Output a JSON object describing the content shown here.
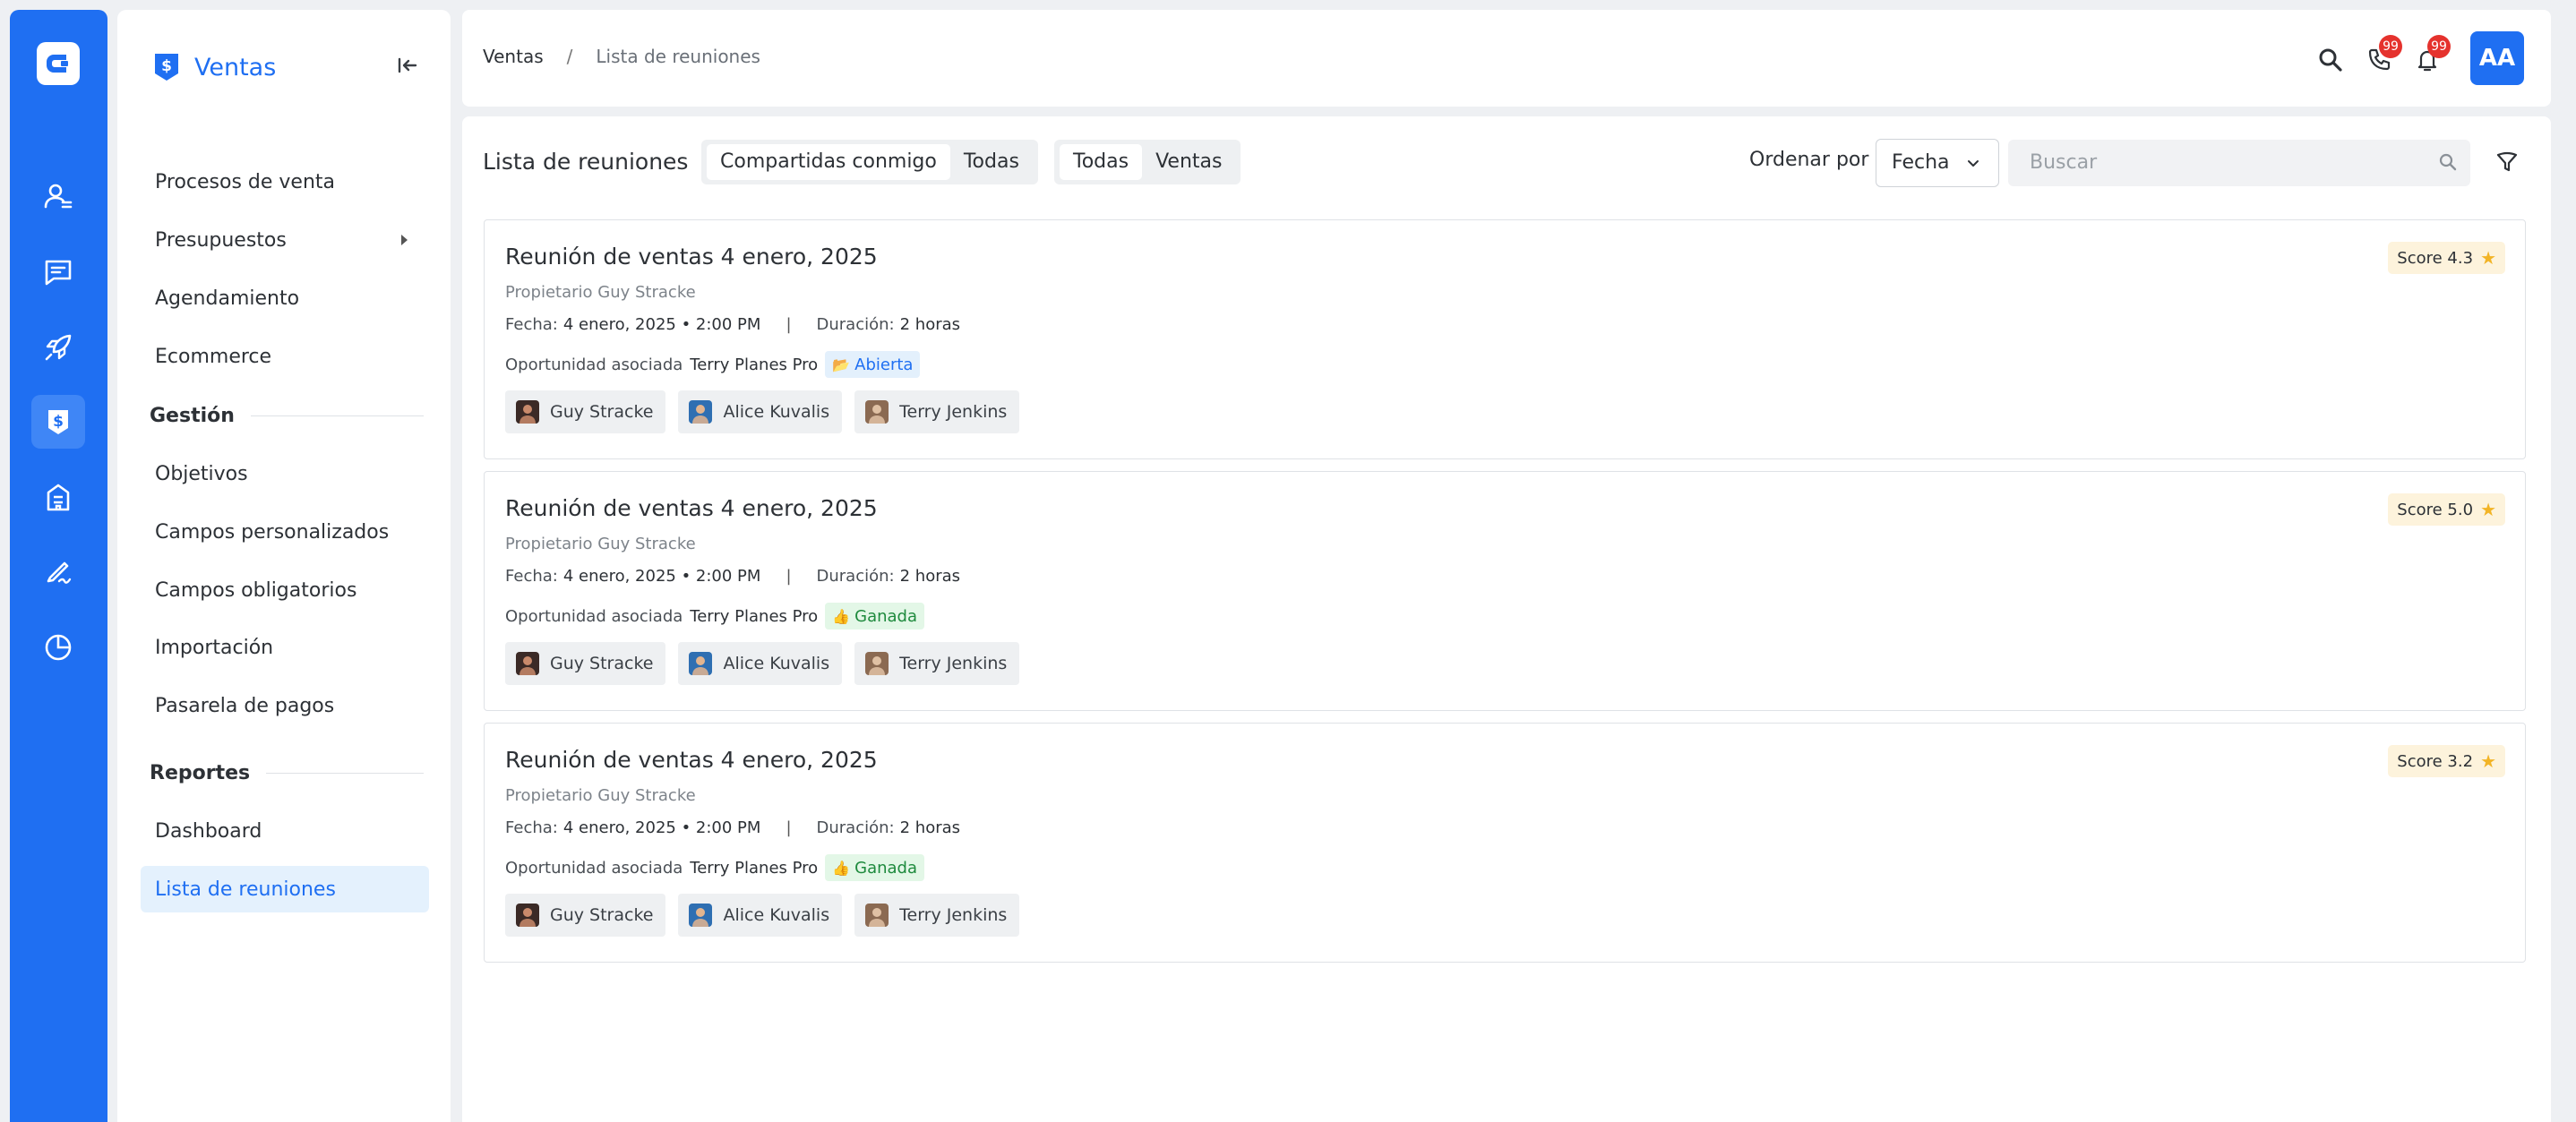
{
  "app": {
    "module_title": "Ventas",
    "rail_icons": [
      "contacts-icon",
      "chat-icon",
      "rocket-icon",
      "sales-icon",
      "building-icon",
      "sign-icon",
      "pie-chart-icon"
    ]
  },
  "sidebar": {
    "items": [
      {
        "label": "Procesos de venta"
      },
      {
        "label": "Presupuestos"
      },
      {
        "label": "Agendamiento"
      },
      {
        "label": "Ecommerce"
      }
    ],
    "section_gestion": "Gestión",
    "gestion_items": [
      {
        "label": "Objetivos"
      },
      {
        "label": "Campos personalizados"
      },
      {
        "label": "Campos obligatorios"
      },
      {
        "label": "Importación"
      },
      {
        "label": "Pasarela de pagos"
      }
    ],
    "section_reportes": "Reportes",
    "reportes_items": [
      {
        "label": "Dashboard"
      },
      {
        "label": "Lista de reuniones"
      }
    ]
  },
  "header": {
    "breadcrumb_root": "Ventas",
    "breadcrumb_sep": "/",
    "breadcrumb_current": "Lista de reuniones",
    "phone_badge": "99",
    "bell_badge": "99",
    "user_initials": "AA"
  },
  "toolbar": {
    "title": "Lista de reuniones",
    "share_filter": [
      "Compartidas conmigo",
      "Todas"
    ],
    "type_filter": [
      "Todas",
      "Ventas"
    ],
    "sort_label": "Ordenar por",
    "sort_value": "Fecha",
    "search_placeholder": "Buscar"
  },
  "meetings": [
    {
      "title": "Reunión de ventas 4 enero, 2025",
      "owner": "Propietario Guy Stracke",
      "date_label": "Fecha:",
      "date_value": "4 enero, 2025 • 2:00 PM",
      "sep": "|",
      "duration_label": "Duración:",
      "duration_value": "2 horas",
      "opp_label": "Oportunidad asociada",
      "opp_value": "Terry Planes Pro",
      "status": "Abierta",
      "score": "Score 4.3",
      "participants": [
        "Guy Stracke",
        "Alice Kuvalis",
        "Terry Jenkins"
      ]
    },
    {
      "title": "Reunión de ventas 4 enero, 2025",
      "owner": "Propietario Guy Stracke",
      "date_label": "Fecha:",
      "date_value": "4 enero, 2025 • 2:00 PM",
      "sep": "|",
      "duration_label": "Duración:",
      "duration_value": "2 horas",
      "opp_label": "Oportunidad asociada",
      "opp_value": "Terry Planes Pro",
      "status": "Ganada",
      "score": "Score 5.0",
      "participants": [
        "Guy Stracke",
        "Alice Kuvalis",
        "Terry Jenkins"
      ]
    },
    {
      "title": "Reunión de ventas 4 enero, 2025",
      "owner": "Propietario Guy Stracke",
      "date_label": "Fecha:",
      "date_value": "4 enero, 2025 • 2:00 PM",
      "sep": "|",
      "duration_label": "Duración:",
      "duration_value": "2 horas",
      "opp_label": "Oportunidad asociada",
      "opp_value": "Terry Planes Pro",
      "status": "Ganada",
      "score": "Score 3.2",
      "participants": [
        "Guy Stracke",
        "Alice Kuvalis",
        "Terry Jenkins"
      ]
    }
  ],
  "colors": {
    "brand": "#1f6ff2",
    "active_bg": "#e4f1fd",
    "open_status": "#1f6ff2",
    "won_status": "#1e8a3d",
    "score_bg": "#fdf3dc",
    "badge": "#e5322d"
  }
}
